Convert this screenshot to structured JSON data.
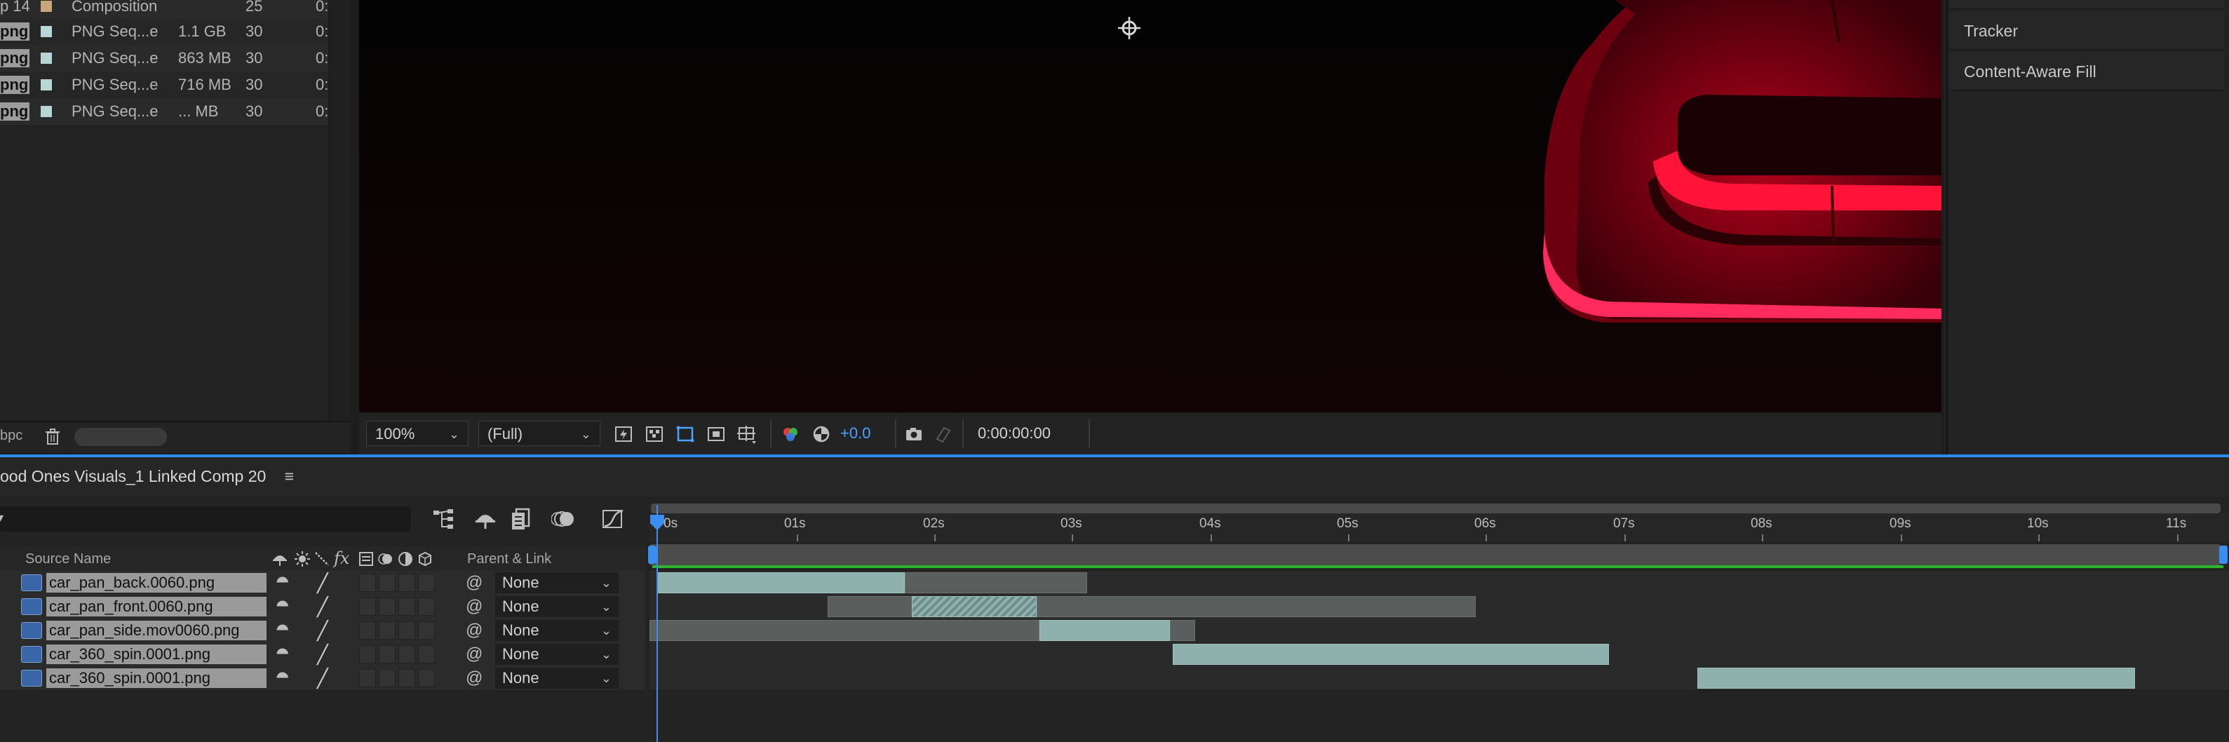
{
  "colors": {
    "accent_blue": "#2d8ceb",
    "green_bar": "#2fb52f",
    "layer_teal": "#8fb1ae",
    "composition_swatch": "#c9a77a",
    "png_swatch": "#b9d6d6"
  },
  "project": {
    "rows": [
      {
        "name": "p 14",
        "type": "Composition",
        "size": "",
        "fps": "25",
        "extra": "0:",
        "swatch": "composition"
      },
      {
        "name": "png",
        "type": "PNG Seq...e",
        "size": "1.1 GB",
        "fps": "30",
        "extra": "0:",
        "swatch": "png"
      },
      {
        "name": "png",
        "type": "PNG Seq...e",
        "size": "863 MB",
        "fps": "30",
        "extra": "0:",
        "swatch": "png"
      },
      {
        "name": "png",
        "type": "PNG Seq...e",
        "size": "716 MB",
        "fps": "30",
        "extra": "0:",
        "swatch": "png"
      },
      {
        "name": "png",
        "type": "PNG Seq...e",
        "size": "... MB",
        "fps": "30",
        "extra": "0:",
        "swatch": "png"
      }
    ],
    "bpc_label": "bpc"
  },
  "viewer": {
    "zoom": "100%",
    "resolution": "(Full)",
    "exposure": "+0.0",
    "timecode": "0:00:00:00"
  },
  "right_panel": {
    "items": [
      "Tracker",
      "Content-Aware Fill"
    ]
  },
  "timeline": {
    "comp_title": "ood Ones Visuals_1 Linked Comp 20",
    "menu_icon": "≡",
    "columns": {
      "source_name": "Source Name",
      "parent_link": "Parent & Link",
      "fx": "fx"
    },
    "time_labels": [
      "0s",
      "01s",
      "02s",
      "03s",
      "04s",
      "05s",
      "06s",
      "07s",
      "08s",
      "09s",
      "10s",
      "11s"
    ],
    "layers": [
      {
        "name": "car_pan_back.0060.png",
        "parent": "None"
      },
      {
        "name": "car_pan_front.0060.png",
        "parent": "None"
      },
      {
        "name": "car_pan_side.mov0060.png",
        "parent": "None"
      },
      {
        "name": "car_360_spin.0001.png",
        "parent": "None"
      },
      {
        "name": "car_360_spin.0001.png",
        "parent": "None"
      }
    ]
  }
}
